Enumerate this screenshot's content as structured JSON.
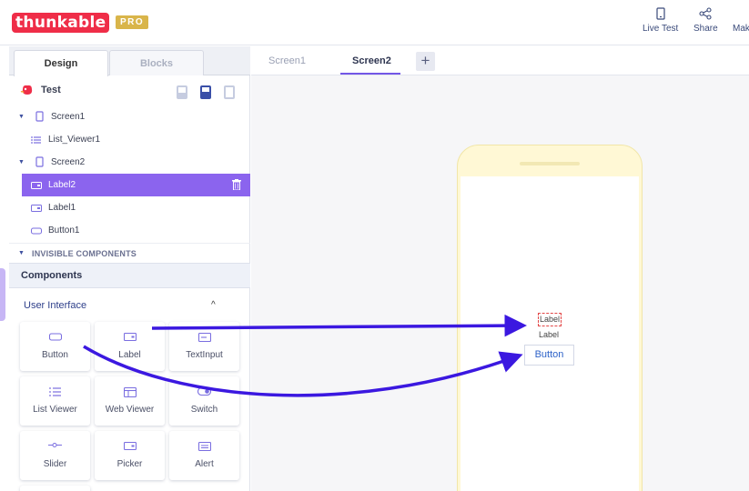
{
  "header": {
    "logo": "thunkable",
    "pro_badge": "PRO",
    "actions": [
      {
        "label": "Live Test",
        "icon": "phone-icon"
      },
      {
        "label": "Share",
        "icon": "share-icon"
      },
      {
        "label": "Mak",
        "icon": "make-icon"
      }
    ]
  },
  "panel": {
    "tabs": {
      "design": "Design",
      "blocks": "Blocks"
    },
    "project": "Test",
    "tree": [
      {
        "label": "Screen1",
        "type": "screen"
      },
      {
        "label": "List_Viewer1",
        "type": "list"
      },
      {
        "label": "Screen2",
        "type": "screen"
      },
      {
        "label": "Label2",
        "type": "label",
        "selected": true
      },
      {
        "label": "Label1",
        "type": "label"
      },
      {
        "label": "Button1",
        "type": "button"
      }
    ],
    "invisible_header": "INVISIBLE COMPONENTS",
    "components_header": "Components",
    "ui_header": "User Interface",
    "ui_caret": "^",
    "components": [
      "Button",
      "Label",
      "TextInput",
      "List Viewer",
      "Web Viewer",
      "Switch",
      "Slider",
      "Picker",
      "Alert"
    ]
  },
  "screen_tabs": {
    "tab1": "Screen1",
    "tab2": "Screen2",
    "add": "+"
  },
  "phone": {
    "label_selected": "Label",
    "label": "Label",
    "button": "Button"
  },
  "colors": {
    "accent": "#8b64ee",
    "brand": "#ef2d48",
    "arrow": "#3b18e0",
    "pro": "#d9b54a"
  }
}
